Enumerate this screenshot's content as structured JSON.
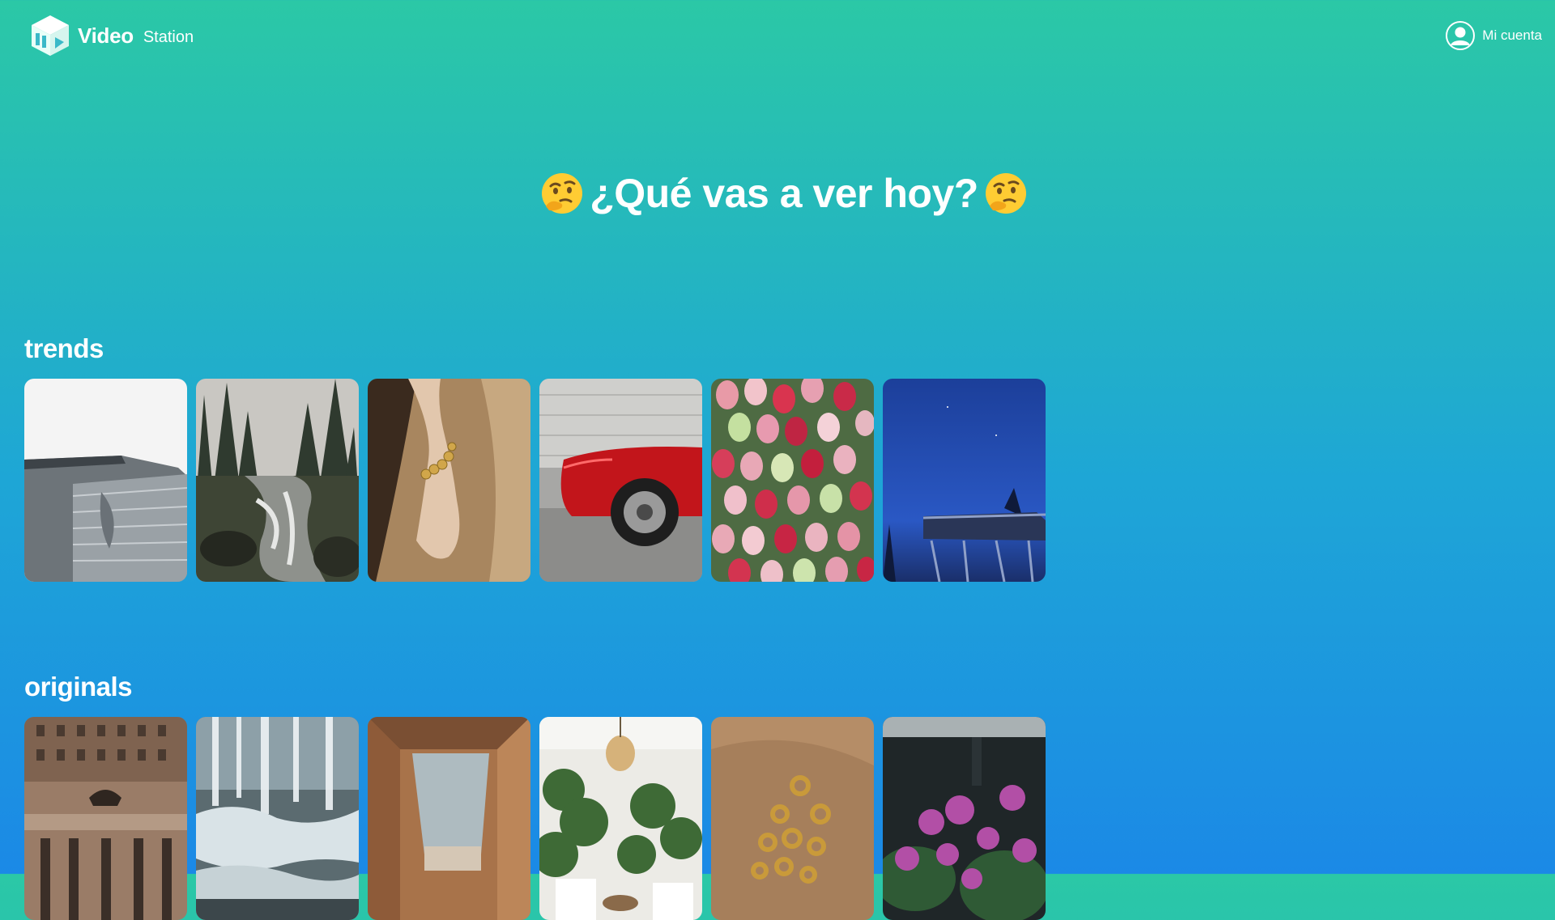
{
  "app": {
    "brand_main": "Video",
    "brand_sub": "Station"
  },
  "header": {
    "account_label": "Mi cuenta"
  },
  "hero": {
    "title": "¿Qué vas a ver hoy?"
  },
  "sections": [
    {
      "title": "trends",
      "items": [
        {
          "name": "modern-building"
        },
        {
          "name": "forest-river"
        },
        {
          "name": "hand-bracelet"
        },
        {
          "name": "red-car"
        },
        {
          "name": "tulips"
        },
        {
          "name": "night-sky-tower"
        }
      ]
    },
    {
      "title": "originals",
      "items": [
        {
          "name": "classic-building"
        },
        {
          "name": "waterfall"
        },
        {
          "name": "skylight"
        },
        {
          "name": "interior-plants"
        },
        {
          "name": "gold-rings"
        },
        {
          "name": "purple-flowers"
        }
      ]
    }
  ],
  "colors": {
    "gradient_top": "#2bc8a6",
    "gradient_bottom": "#1b89e6"
  }
}
